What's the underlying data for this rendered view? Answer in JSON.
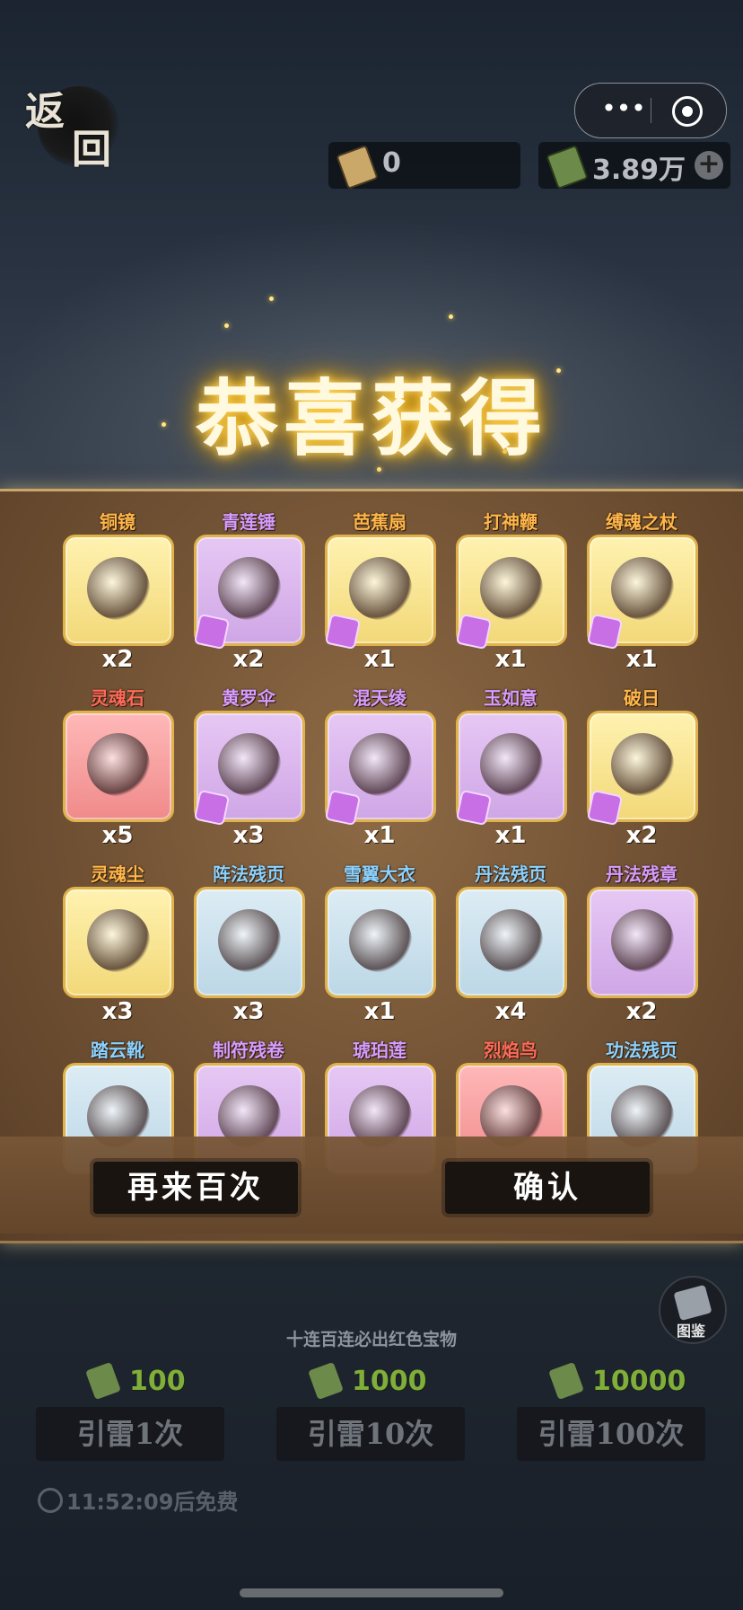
{
  "header": {
    "back_label_top": "返",
    "back_label_bottom": "回",
    "menu_icon": "more-dots-icon",
    "close_icon": "target-circle-icon",
    "menu_glyph": "•••",
    "ticket_count": "0",
    "jade_balance": "3.89万",
    "plus_glyph": "+"
  },
  "title": "恭喜获得",
  "items": [
    {
      "name": "铜镜",
      "count": "x2",
      "rarity": "yellow",
      "name_color": "orange",
      "shard": false
    },
    {
      "name": "青莲锤",
      "count": "x2",
      "rarity": "purple",
      "name_color": "purple",
      "shard": true
    },
    {
      "name": "芭蕉扇",
      "count": "x1",
      "rarity": "yellow",
      "name_color": "orange",
      "shard": true
    },
    {
      "name": "打神鞭",
      "count": "x1",
      "rarity": "yellow",
      "name_color": "orange",
      "shard": true
    },
    {
      "name": "缚魂之杖",
      "count": "x1",
      "rarity": "yellow",
      "name_color": "orange",
      "shard": true
    },
    {
      "name": "灵魂石",
      "count": "x5",
      "rarity": "red",
      "name_color": "red",
      "shard": false
    },
    {
      "name": "黄罗伞",
      "count": "x3",
      "rarity": "purple",
      "name_color": "purple",
      "shard": true
    },
    {
      "name": "混天绫",
      "count": "x1",
      "rarity": "purple",
      "name_color": "purple",
      "shard": true
    },
    {
      "name": "玉如意",
      "count": "x1",
      "rarity": "purple",
      "name_color": "purple",
      "shard": true
    },
    {
      "name": "破日",
      "count": "x2",
      "rarity": "yellow",
      "name_color": "orange",
      "shard": true
    },
    {
      "name": "灵魂尘",
      "count": "x3",
      "rarity": "yellow",
      "name_color": "orange",
      "shard": false
    },
    {
      "name": "阵法残页",
      "count": "x3",
      "rarity": "blue",
      "name_color": "blue",
      "shard": false
    },
    {
      "name": "雪翼大衣",
      "count": "x1",
      "rarity": "blue",
      "name_color": "blue",
      "shard": false
    },
    {
      "name": "丹法残页",
      "count": "x4",
      "rarity": "blue",
      "name_color": "blue",
      "shard": false
    },
    {
      "name": "丹法残章",
      "count": "x2",
      "rarity": "purple",
      "name_color": "purple",
      "shard": false
    },
    {
      "name": "踏云靴",
      "count": "",
      "rarity": "blue",
      "name_color": "blue",
      "shard": false
    },
    {
      "name": "制符残卷",
      "count": "",
      "rarity": "purple",
      "name_color": "purple",
      "shard": false
    },
    {
      "name": "琥珀莲",
      "count": "",
      "rarity": "purple",
      "name_color": "purple",
      "shard": false
    },
    {
      "name": "烈焰鸟",
      "count": "",
      "rarity": "red",
      "name_color": "red",
      "shard": false
    },
    {
      "name": "功法残页",
      "count": "",
      "rarity": "blue",
      "name_color": "blue",
      "shard": false
    }
  ],
  "buttons": {
    "again": "再来百次",
    "confirm": "确认"
  },
  "codex_label": "图鉴",
  "guarantee_text": "十连百连必出红色宝物",
  "costs": [
    "100",
    "1000",
    "10000"
  ],
  "draw_buttons": [
    "引雷1次",
    "引雷10次",
    "引雷100次"
  ],
  "timer": "11:52:09后免费",
  "colors": {
    "panel": "#6e4f32",
    "title_glow": "#ffb400",
    "rarity_yellow": "#f2d878",
    "rarity_purple": "#cfa6e6",
    "rarity_red": "#f08a8a",
    "rarity_blue": "#bcd7e6"
  }
}
